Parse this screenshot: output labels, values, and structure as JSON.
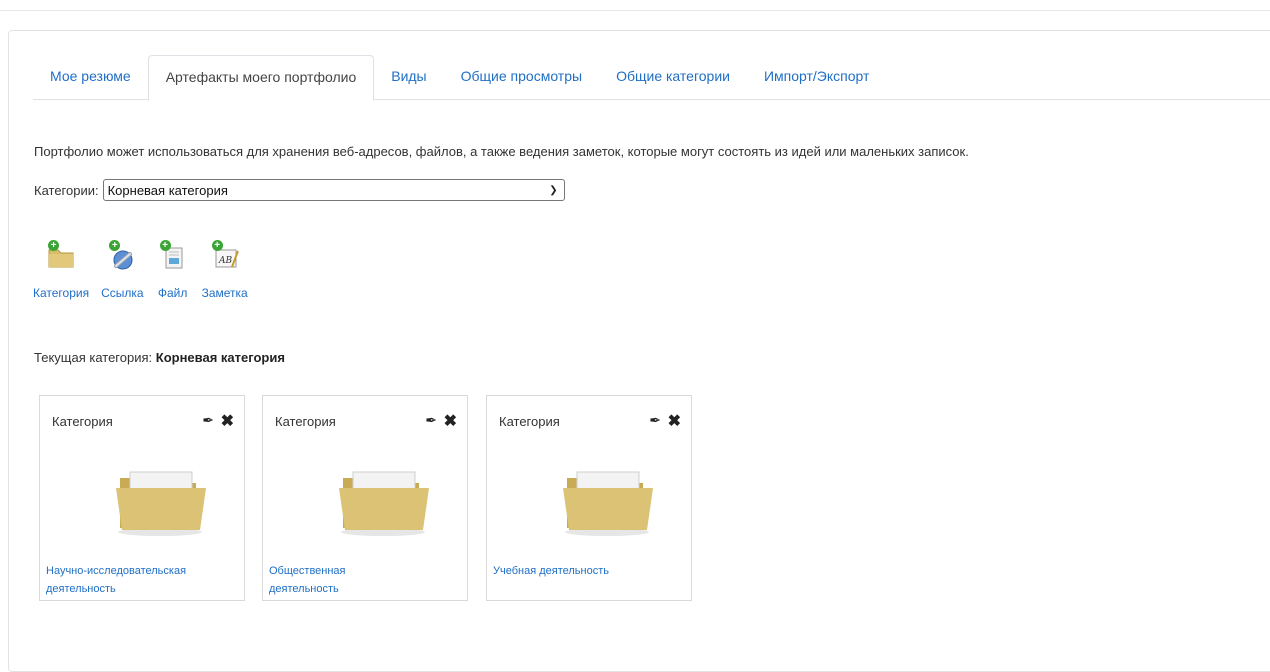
{
  "tabs": [
    {
      "label": "Мое резюме",
      "active": false
    },
    {
      "label": "Артефакты моего портфолио",
      "active": true
    },
    {
      "label": "Виды",
      "active": false
    },
    {
      "label": "Общие просмотры",
      "active": false
    },
    {
      "label": "Общие категории",
      "active": false
    },
    {
      "label": "Импорт/Экспорт",
      "active": false
    }
  ],
  "intro_text": "Портфолио может использоваться для хранения веб-адресов, файлов, а также ведения заметок, которые могут состоять из идей или маленьких записок.",
  "category_select": {
    "label": "Категории:",
    "value": "Корневая категория"
  },
  "actions": [
    {
      "label": "Категория",
      "icon": "add-folder-icon"
    },
    {
      "label": "Ссылка",
      "icon": "add-link-icon"
    },
    {
      "label": "Файл",
      "icon": "add-file-icon"
    },
    {
      "label": "Заметка",
      "icon": "add-note-icon"
    }
  ],
  "current_category": {
    "label": "Текущая категория:",
    "value": "Корневая категория"
  },
  "cards": [
    {
      "type": "Категория",
      "title": "Научно-исследовательская деятельность"
    },
    {
      "type": "Категория",
      "title": "Общественная деятельность"
    },
    {
      "type": "Категория",
      "title": "Учебная деятельность"
    }
  ],
  "colors": {
    "link": "#1f6fc6",
    "folder": "#d7bd6a"
  }
}
